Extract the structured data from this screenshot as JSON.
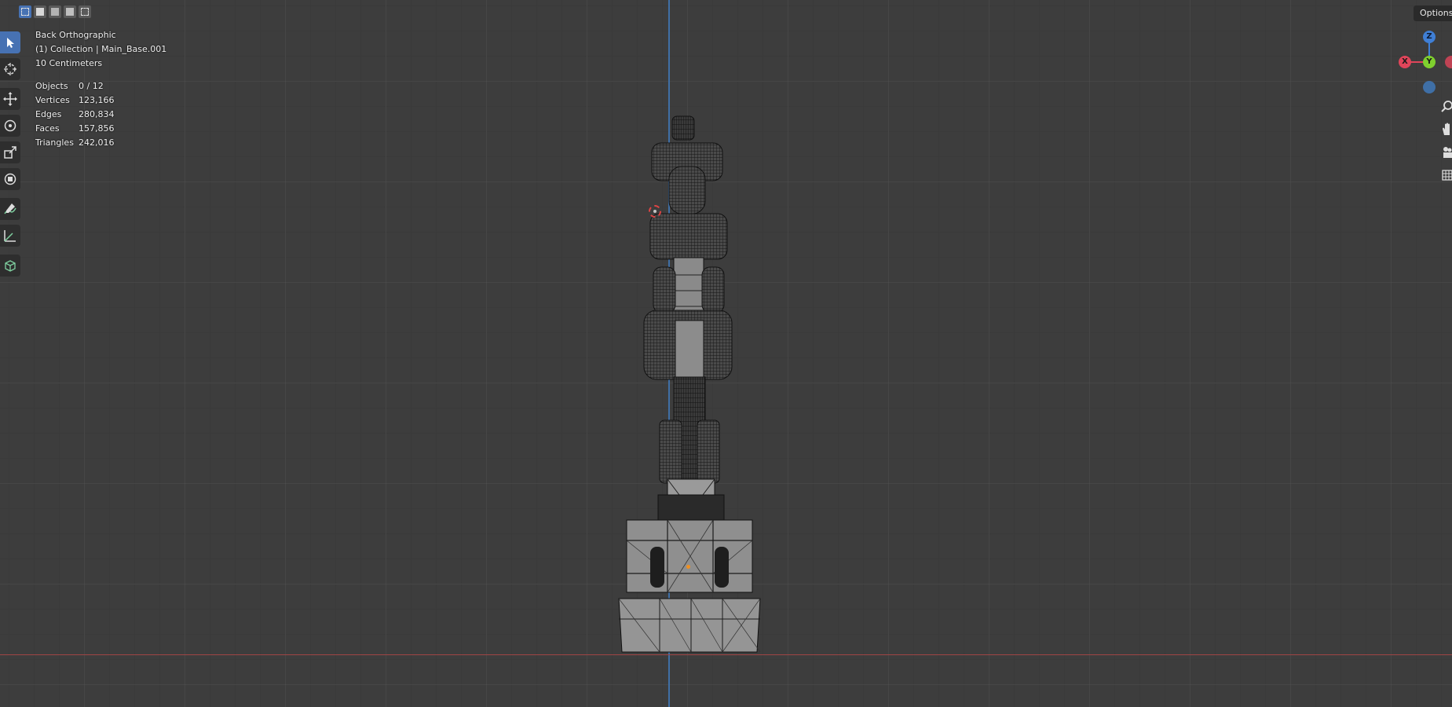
{
  "viewport": {
    "view_name": "Back Orthographic",
    "collection_line": "(1) Collection | Main_Base.001",
    "scale_label": "10 Centimeters"
  },
  "stats": [
    {
      "label": "Objects",
      "value": "0 / 12"
    },
    {
      "label": "Vertices",
      "value": "123,166"
    },
    {
      "label": "Edges",
      "value": "280,834"
    },
    {
      "label": "Faces",
      "value": "157,856"
    },
    {
      "label": "Triangles",
      "value": "242,016"
    }
  ],
  "header": {
    "options_label": "Options"
  },
  "gizmo": {
    "z": "Z",
    "y": "Y",
    "x": "X"
  },
  "toolbar": {
    "tools": [
      "select-box-icon",
      "cursor-icon",
      "move-icon",
      "rotate-icon",
      "scale-icon",
      "transform-icon",
      "annotate-icon",
      "measure-icon",
      "add-cube-icon"
    ]
  },
  "colors": {
    "accent": "#4772b3",
    "axis_x": "#e0455a",
    "axis_y": "#7fcf2e",
    "axis_z": "#3f7fd6",
    "background": "#3d3d3d"
  }
}
